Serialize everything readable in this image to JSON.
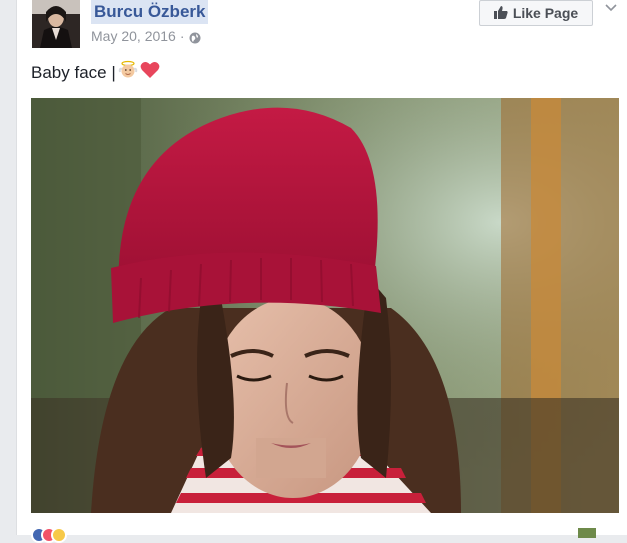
{
  "post": {
    "author": "Burcu Özberk",
    "date": "May 20, 2016",
    "separator": "·",
    "privacy_icon": "globe-icon",
    "text": "Baby face |",
    "emojis": [
      "baby-angel-emoji",
      "red-heart-emoji"
    ]
  },
  "header": {
    "like_page_label": "Like Page",
    "like_icon": "thumbs-up-icon",
    "menu_icon": "chevron-down-icon"
  },
  "reactions": [
    "like-reaction",
    "love-reaction",
    "haha-reaction"
  ],
  "colors": {
    "link_blue": "#385898",
    "name_highlight": "#dbe4f3",
    "meta_gray": "#90949c",
    "hat_red": "#b3123a",
    "shirt_red": "#c8203a"
  }
}
